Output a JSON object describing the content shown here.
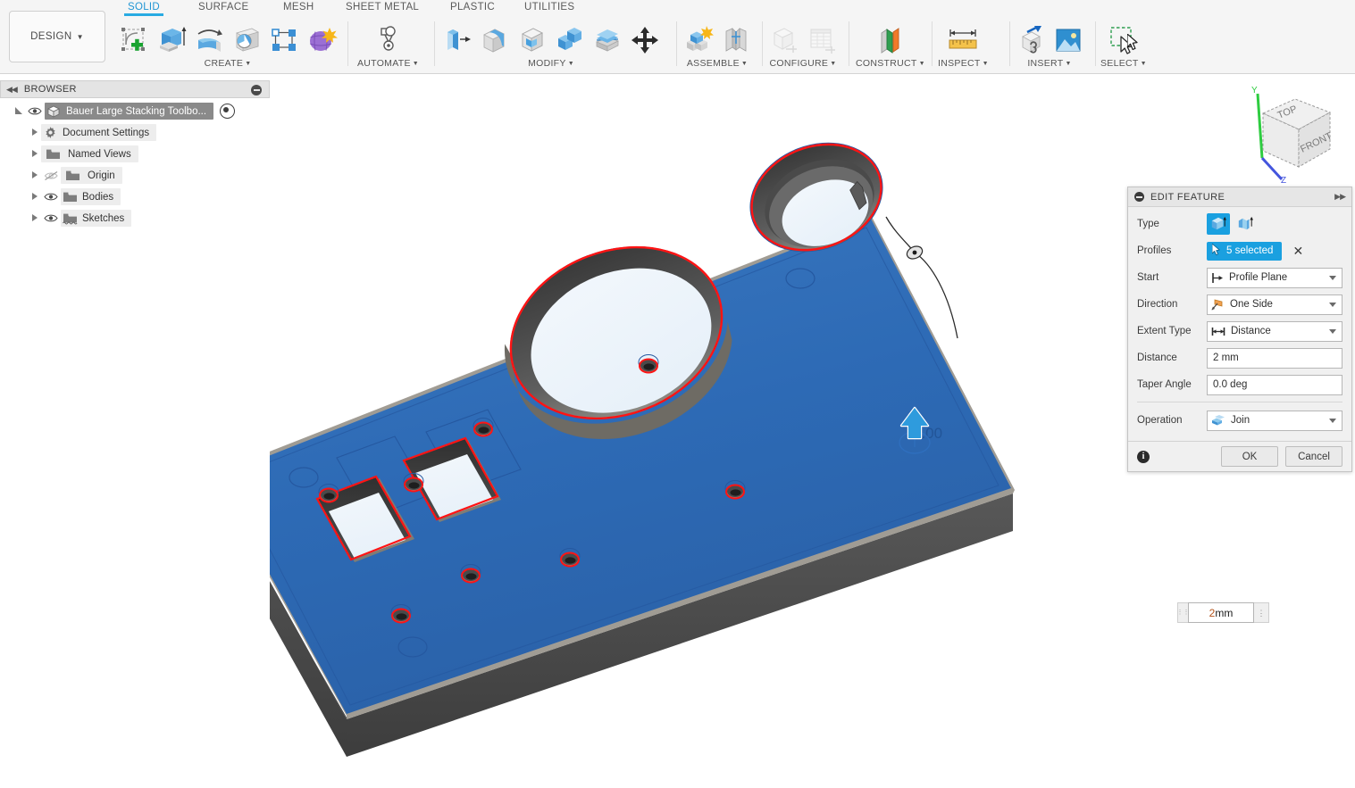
{
  "app": {
    "workspace_label": "DESIGN",
    "tabs": [
      {
        "label": "SOLID",
        "active": true
      },
      {
        "label": "SURFACE",
        "active": false
      },
      {
        "label": "MESH",
        "active": false
      },
      {
        "label": "SHEET METAL",
        "active": false
      },
      {
        "label": "PLASTIC",
        "active": false
      },
      {
        "label": "UTILITIES",
        "active": false
      }
    ],
    "groups": [
      {
        "label": "CREATE",
        "caret": true
      },
      {
        "label": "AUTOMATE",
        "caret": true
      },
      {
        "label": "MODIFY",
        "caret": true
      },
      {
        "label": "ASSEMBLE",
        "caret": true
      },
      {
        "label": "CONFIGURE",
        "caret": true
      },
      {
        "label": "CONSTRUCT",
        "caret": true
      },
      {
        "label": "INSPECT",
        "caret": true
      },
      {
        "label": "INSERT",
        "caret": true
      },
      {
        "label": "SELECT",
        "caret": true
      }
    ]
  },
  "browser": {
    "title": "BROWSER",
    "items": [
      {
        "label": "Bauer Large Stacking Toolbo...",
        "icon": "component-icon",
        "selected": true,
        "expanded": true,
        "eye": "visible",
        "dot": true
      },
      {
        "label": "Document Settings",
        "icon": "gear-icon",
        "selected": false,
        "expanded": false,
        "eye": "none",
        "dot": false
      },
      {
        "label": "Named Views",
        "icon": "folder-icon",
        "selected": false,
        "expanded": false,
        "eye": "none",
        "dot": false
      },
      {
        "label": "Origin",
        "icon": "folder-icon",
        "selected": false,
        "expanded": false,
        "eye": "hidden",
        "dot": false
      },
      {
        "label": "Bodies",
        "icon": "folder-icon",
        "selected": false,
        "expanded": false,
        "eye": "visible",
        "dot": false
      },
      {
        "label": "Sketches",
        "icon": "folder-sketch-icon",
        "selected": false,
        "expanded": false,
        "eye": "visible",
        "dot": false
      }
    ]
  },
  "viewcube": {
    "top_face": "TOP",
    "front_face": "FRONT",
    "axis_y": "Y",
    "axis_z": "Z"
  },
  "canvas": {
    "dimension_value": "2 mm",
    "dimension_number": "2",
    "dimension_unit": " mm"
  },
  "dialog": {
    "title": "EDIT FEATURE",
    "fields": {
      "type_label": "Type",
      "profiles_label": "Profiles",
      "profiles_value": "5 selected",
      "start_label": "Start",
      "start_value": "Profile Plane",
      "direction_label": "Direction",
      "direction_value": "One Side",
      "extent_label": "Extent Type",
      "extent_value": "Distance",
      "distance_label": "Distance",
      "distance_value": "2 mm",
      "taper_label": "Taper Angle",
      "taper_value": "0.0 deg",
      "operation_label": "Operation",
      "operation_value": "Join"
    },
    "buttons": {
      "ok": "OK",
      "cancel": "Cancel"
    }
  },
  "colors": {
    "accent_blue": "#1aa0e0",
    "tab_active": "#2196d4",
    "model_blue": "#2d6ab5",
    "selection_red": "#ff1010",
    "toolbar_bg": "#f5f5f5",
    "dialog_bg": "#f0f0f0"
  }
}
